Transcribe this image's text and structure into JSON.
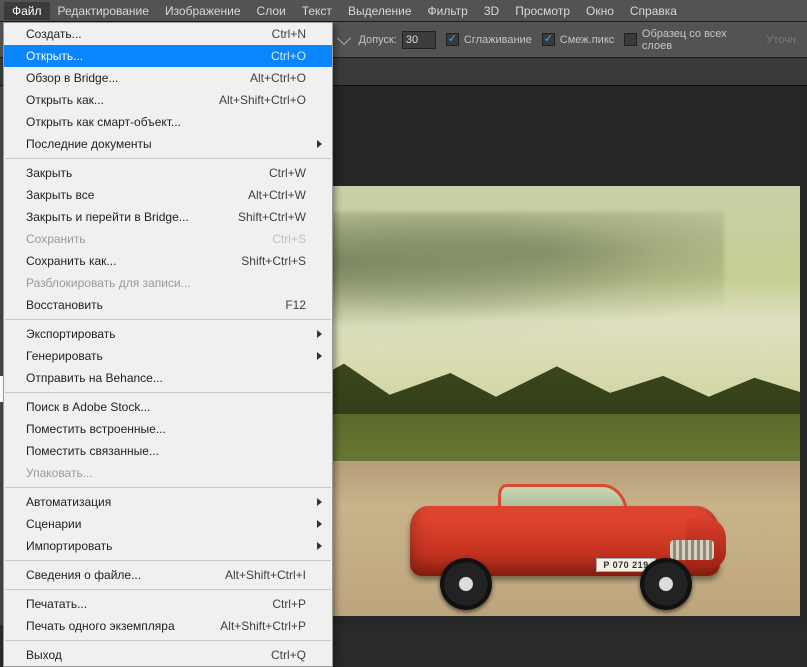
{
  "menubar": {
    "items": [
      "Файл",
      "Редактирование",
      "Изображение",
      "Слои",
      "Текст",
      "Выделение",
      "Фильтр",
      "3D",
      "Просмотр",
      "Окно",
      "Справка"
    ],
    "active_index": 0
  },
  "toolbar": {
    "tolerance_label": "Допуск:",
    "tolerance_value": "30",
    "antialias_label": "Сглаживание",
    "antialias_checked": true,
    "contiguous_label": "Смеж.пикс",
    "contiguous_checked": true,
    "all_layers_label": "Образец со всех слоев",
    "all_layers_checked": false,
    "right_hint": "Уточн."
  },
  "file_menu": {
    "groups": [
      [
        {
          "label": "Создать...",
          "shortcut": "Ctrl+N"
        },
        {
          "label": "Открыть...",
          "shortcut": "Ctrl+O",
          "highlight": true
        },
        {
          "label": "Обзор в Bridge...",
          "shortcut": "Alt+Ctrl+O"
        },
        {
          "label": "Открыть как...",
          "shortcut": "Alt+Shift+Ctrl+O"
        },
        {
          "label": "Открыть как смарт-объект..."
        },
        {
          "label": "Последние документы",
          "submenu": true
        }
      ],
      [
        {
          "label": "Закрыть",
          "shortcut": "Ctrl+W"
        },
        {
          "label": "Закрыть все",
          "shortcut": "Alt+Ctrl+W"
        },
        {
          "label": "Закрыть и перейти в Bridge...",
          "shortcut": "Shift+Ctrl+W"
        },
        {
          "label": "Сохранить",
          "shortcut": "Ctrl+S",
          "disabled": true
        },
        {
          "label": "Сохранить как...",
          "shortcut": "Shift+Ctrl+S"
        },
        {
          "label": "Разблокировать для записи...",
          "disabled": true
        },
        {
          "label": "Восстановить",
          "shortcut": "F12"
        }
      ],
      [
        {
          "label": "Экспортировать",
          "submenu": true
        },
        {
          "label": "Генерировать",
          "submenu": true
        },
        {
          "label": "Отправить на Behance..."
        }
      ],
      [
        {
          "label": "Поиск в Adobe Stock..."
        },
        {
          "label": "Поместить встроенные..."
        },
        {
          "label": "Поместить связанные..."
        },
        {
          "label": "Упаковать...",
          "disabled": true
        }
      ],
      [
        {
          "label": "Автоматизация",
          "submenu": true
        },
        {
          "label": "Сценарии",
          "submenu": true
        },
        {
          "label": "Импортировать",
          "submenu": true
        }
      ],
      [
        {
          "label": "Сведения о файле...",
          "shortcut": "Alt+Shift+Ctrl+I"
        }
      ],
      [
        {
          "label": "Печатать...",
          "shortcut": "Ctrl+P"
        },
        {
          "label": "Печать одного экземпляра",
          "shortcut": "Alt+Shift+Ctrl+P"
        }
      ],
      [
        {
          "label": "Выход",
          "shortcut": "Ctrl+Q"
        }
      ]
    ]
  },
  "canvas": {
    "license_plate": "P 070 219"
  }
}
